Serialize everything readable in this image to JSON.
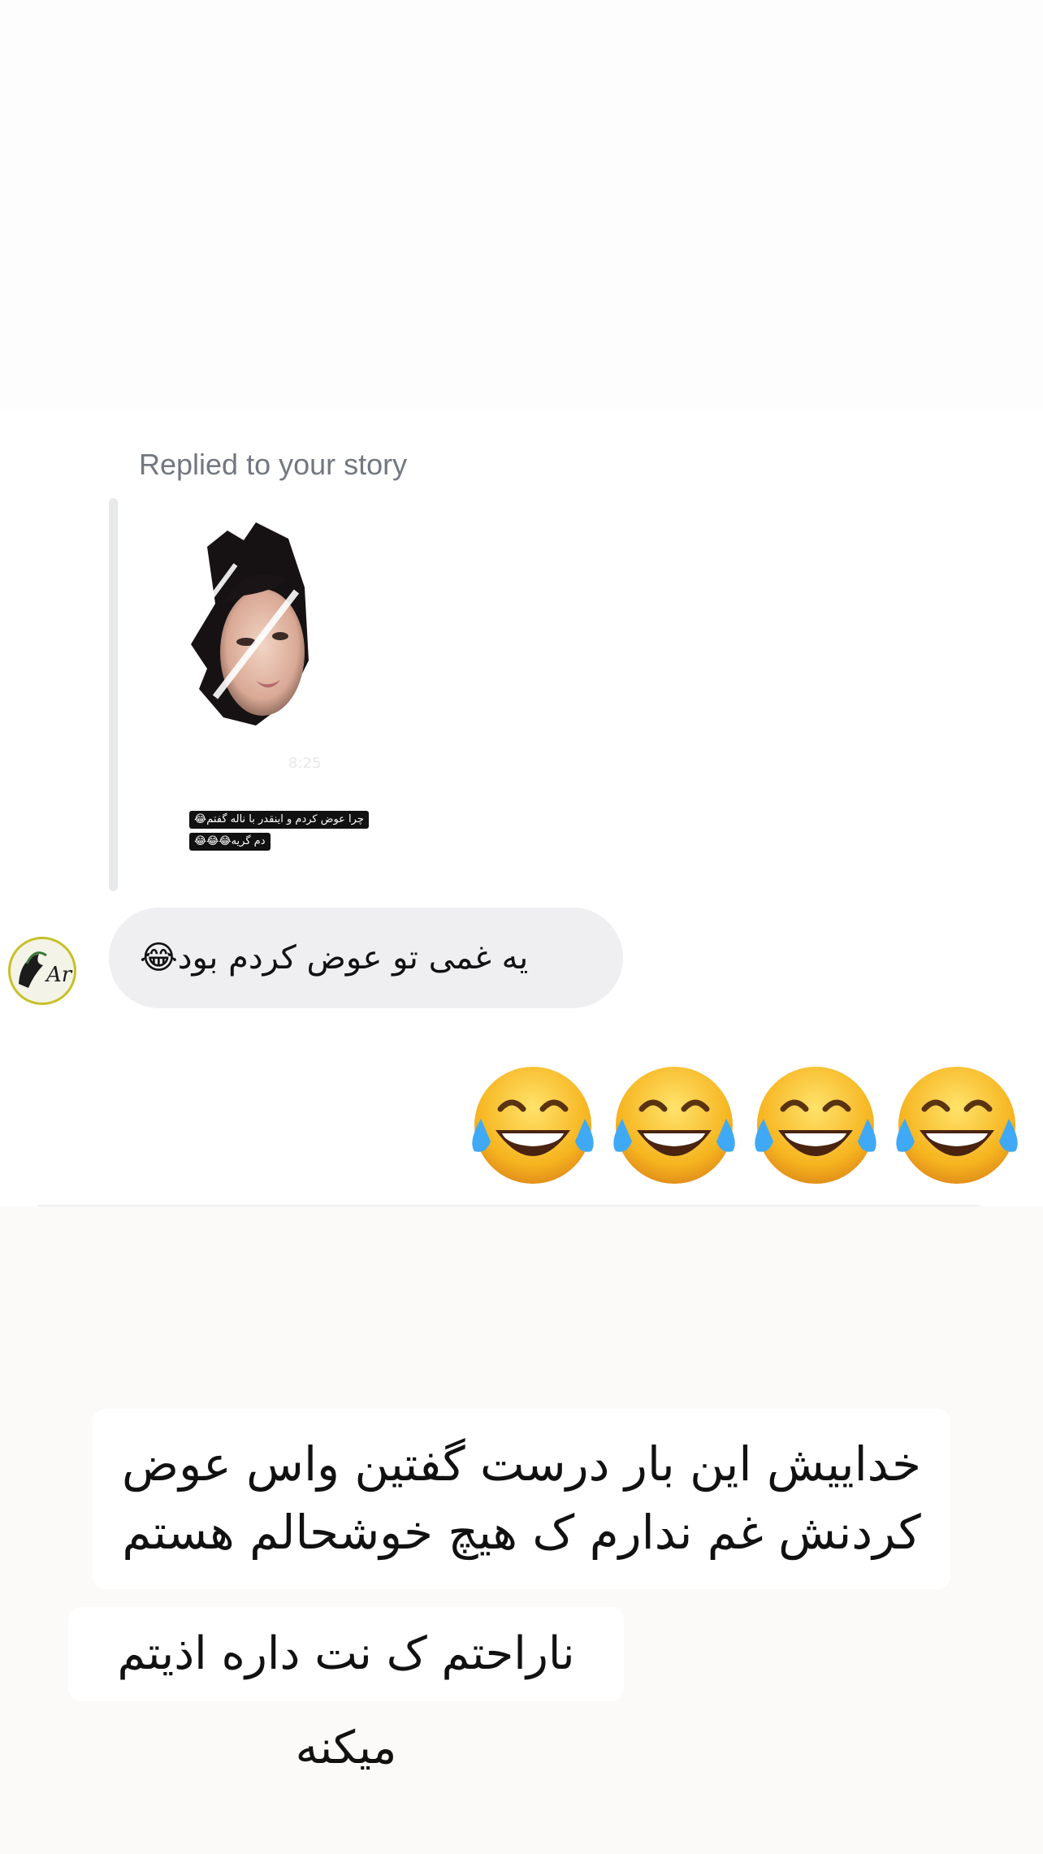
{
  "story_reply": {
    "label": "Replied to your story",
    "story_caption_line1": "چرا عوض کردم و اینقدر با ناله گفتم😂",
    "story_caption_line2": "دم گریه😂😂😂"
  },
  "message": {
    "text": "یه غمی تو عوض کردم بود😂",
    "avatar_text": "Ar"
  },
  "reaction": {
    "emojis": "😂😂😂😂"
  },
  "notes": {
    "line1": "خداییش این بار درست گفتین واس عوض کردنش غم ندارم ک هیچ خوشحالم هستم",
    "line2": "ناراحتم ک نت داره اذیتم میکنه"
  },
  "colors": {
    "bubble": "#efeff1",
    "label": "#737780",
    "avatar_ring": "#c7c02a"
  }
}
